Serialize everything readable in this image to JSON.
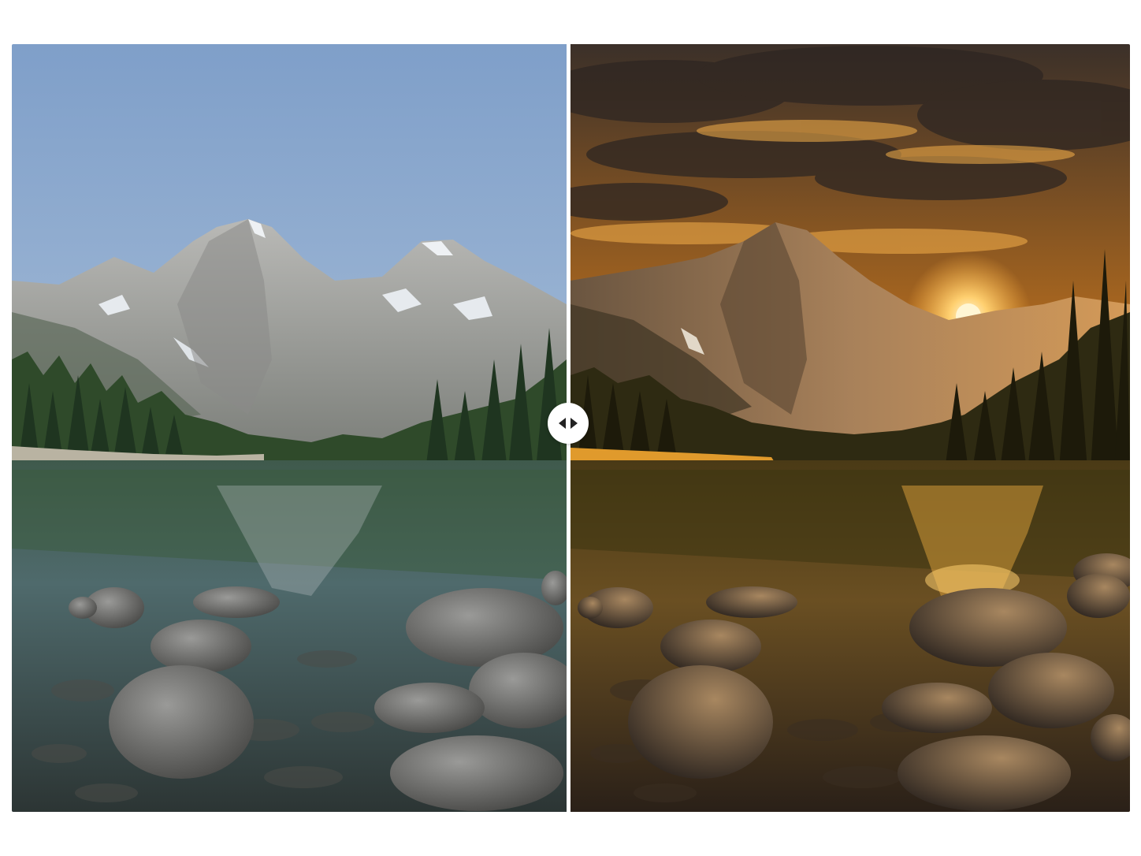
{
  "viewer": {
    "type": "before-after-comparison",
    "split_position_percent": 49.6,
    "handle_icon": "left-right-arrows-icon",
    "divider_color": "#ffffff",
    "handle_color": "#ffffff"
  },
  "before_image": {
    "scene": "mountain-lake-daylight",
    "palette": {
      "sky_top": "#7f9fc9",
      "sky_bottom": "#b8cde0",
      "mountain": "#a7a8a6",
      "forest": "#2f4a2a",
      "water": "#3d5a5a",
      "rock": "#6a6a68"
    }
  },
  "after_image": {
    "scene": "mountain-lake-sunset",
    "palette": {
      "sky_top": "#3a3028",
      "sky_glow": "#f0a030",
      "sun": "#fff1c0",
      "mountain": "#8a6a48",
      "forest": "#2e2a12",
      "water": "#4a3a20",
      "rock": "#4a3e32"
    }
  }
}
